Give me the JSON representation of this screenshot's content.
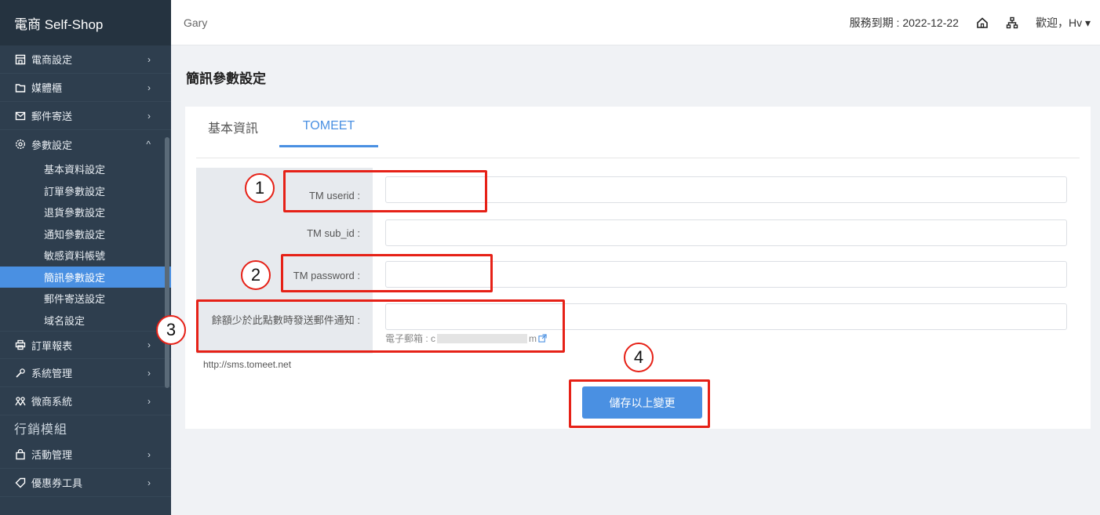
{
  "sidebar": {
    "brand": "電商 Self-Shop",
    "items": [
      {
        "icon": "store-icon",
        "label": "電商設定",
        "arrow": "›"
      },
      {
        "icon": "folder-icon",
        "label": "媒體櫃",
        "arrow": "›"
      },
      {
        "icon": "mail-icon",
        "label": "郵件寄送",
        "arrow": "›"
      },
      {
        "icon": "gear-icon",
        "label": "參數設定",
        "arrow": "^"
      }
    ],
    "sub_items": [
      {
        "label": "基本資料設定",
        "active": false
      },
      {
        "label": "訂單參數設定",
        "active": false
      },
      {
        "label": "退貨參數設定",
        "active": false
      },
      {
        "label": "通知參數設定",
        "active": false
      },
      {
        "label": "敏感資料帳號",
        "active": false
      },
      {
        "label": "簡訊參數設定",
        "active": true
      },
      {
        "label": "郵件寄送設定",
        "active": false
      },
      {
        "label": "域名設定",
        "active": false
      }
    ],
    "items2": [
      {
        "icon": "printer-icon",
        "label": "訂單報表",
        "arrow": "›"
      },
      {
        "icon": "tools-icon",
        "label": "系統管理",
        "arrow": "›"
      },
      {
        "icon": "people-icon",
        "label": "微商系統",
        "arrow": "›"
      }
    ],
    "section": "行銷模組",
    "items3": [
      {
        "icon": "bag-icon",
        "label": "活動管理",
        "arrow": "›"
      },
      {
        "icon": "tag-icon",
        "label": "優惠券工具",
        "arrow": "›"
      }
    ]
  },
  "header": {
    "user": "Gary",
    "expire": "服務到期 : 2022-12-22",
    "welcome": "歡迎，Hv ▾"
  },
  "main": {
    "title": "簡訊參數設定",
    "tabs": [
      "基本資訊",
      "TOMEET"
    ],
    "fields": [
      {
        "label": "TM userid :",
        "value": ""
      },
      {
        "label": "TM sub_id :",
        "value": ""
      },
      {
        "label": "TM password :",
        "value": ""
      },
      {
        "label": "餘額少於此點數時發送郵件通知 :",
        "value": ""
      }
    ],
    "hint_prefix": "電子郵箱 : c",
    "hint_suffix": "m",
    "link": "http://sms.tomeet.net",
    "save_label": "儲存以上變更"
  },
  "annotations": {
    "color": "#e62117",
    "numbers": [
      "1",
      "2",
      "3",
      "4"
    ]
  },
  "colors": {
    "sidebar_bg": "#2e3e4e",
    "accent": "#4a90e2"
  }
}
